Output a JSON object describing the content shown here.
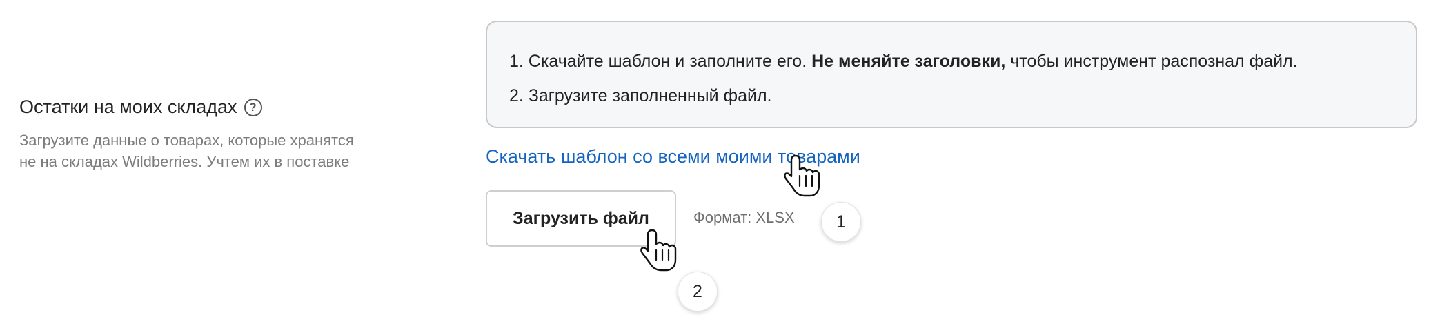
{
  "section": {
    "title": "Остатки на моих складах",
    "help_icon": "question-circle-icon",
    "description_lines": [
      "Загрузите данные о товарах, которые хранятся",
      "не на складах Wildberries. Учтем их в поставке"
    ]
  },
  "instructions": {
    "step1_start": "1. Скачайте шаблон и заполните его. ",
    "step1_bold": "Не меняйте заголовки,",
    "step1_end": " чтобы инструмент распознал файл.",
    "step2": "2. Загрузите заполненный файл."
  },
  "download_link": "Скачать шаблон со всеми моими товарами",
  "upload": {
    "button_label": "Загрузить файл",
    "format": "Формат: XLSX"
  },
  "annotations": {
    "badge1": "1",
    "badge2": "2",
    "cursor_icon": "hand-pointer-icon"
  },
  "colors": {
    "link": "#1565c0",
    "box_background": "#f6f7f9",
    "box_border": "#c8c8c8"
  }
}
